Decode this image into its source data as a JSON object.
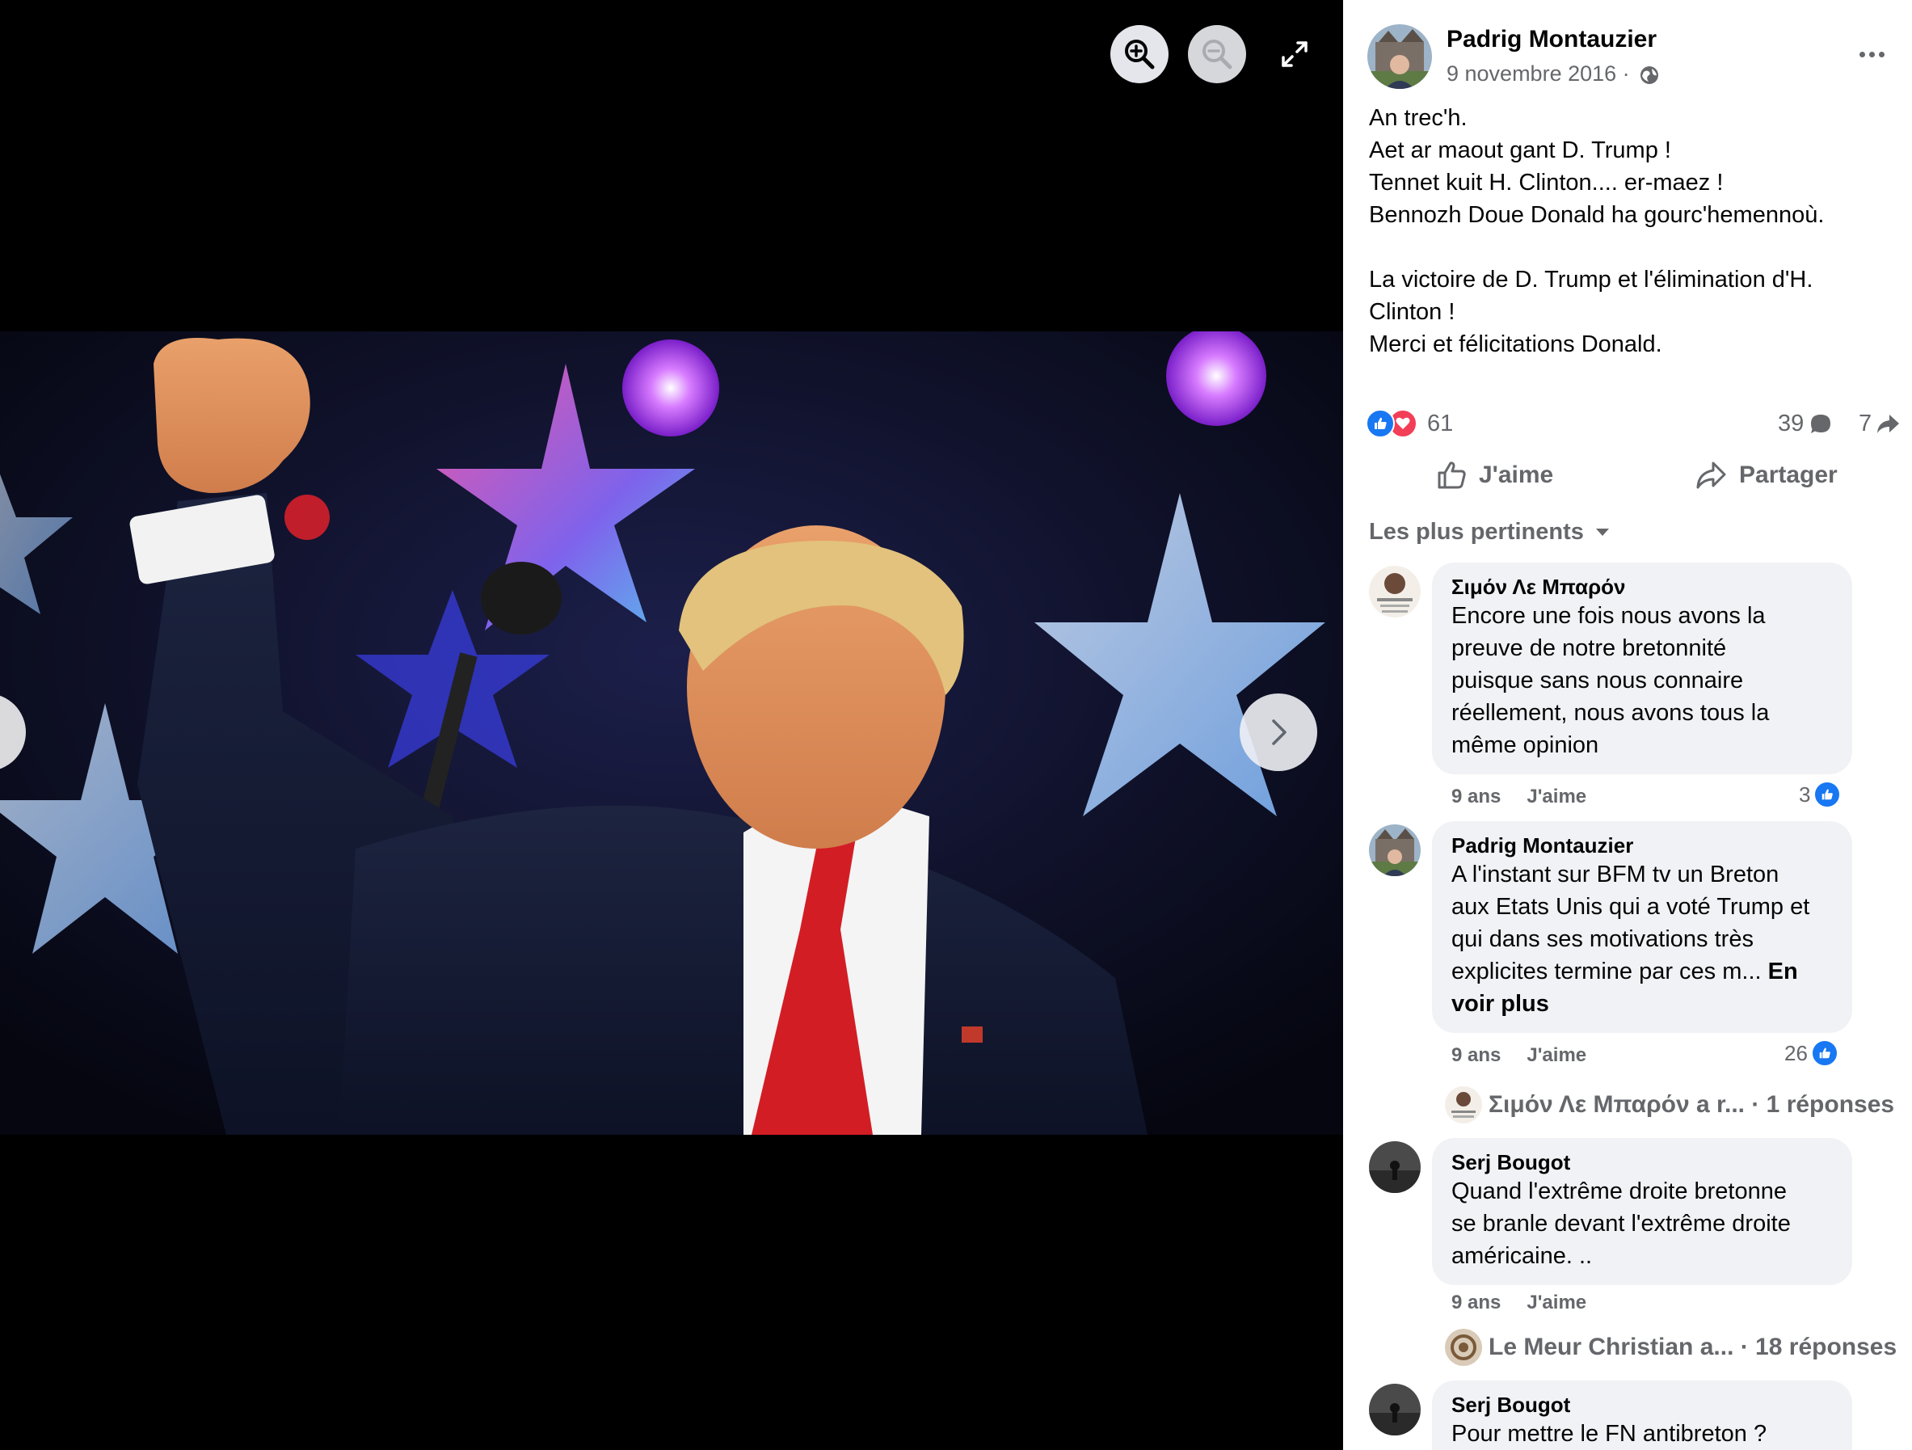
{
  "viewer": {
    "zoom_in_icon": "zoom-in-icon",
    "zoom_out_icon": "zoom-out-icon",
    "fullscreen_icon": "expand-icon",
    "next_icon": "chevron-right-icon",
    "photo": {
      "subject": "man raising fist at podium"
    }
  },
  "post": {
    "author": "Padrig Montauzier",
    "date": "9 novembre 2016 ·",
    "privacy_icon": "globe-icon",
    "text_lines": [
      "An trec'h.",
      "Aet ar maout gant D. Trump !",
      "Tennet kuit H. Clinton.... er-maez !",
      "Bennozh Doue Donald ha gourc'hemennoù.",
      "",
      "La victoire de D. Trump et l'élimination d'H.",
      "Clinton !",
      "Merci et félicitations Donald."
    ],
    "reaction_count": "61",
    "comment_count": "39",
    "share_count": "7",
    "like_label": "J'aime",
    "share_label": "Partager"
  },
  "comments_section": {
    "sort_label": "Les plus pertinents",
    "comments": [
      {
        "author": "Σιμόν Λε Μπαρόν",
        "text_lines": [
          "Encore une fois nous avons la",
          "preuve de notre bretonnité",
          "puisque sans nous connaire",
          "réellement, nous avons tous la",
          "même opinion"
        ],
        "time": "9 ans",
        "like_label": "J'aime",
        "likes": "3"
      },
      {
        "author": "Padrig Montauzier",
        "text_lines": [
          "A l'instant sur BFM tv un Breton",
          "aux Etats Unis qui a voté Trump et",
          "qui dans ses motivations très",
          "explicites termine par ces m..."
        ],
        "see_more_a": "En",
        "see_more_b": "voir plus",
        "time": "9 ans",
        "like_label": "J'aime",
        "likes": "26",
        "replies": "Σιμόν Λε Μπαρόν a r... · 1 réponses"
      },
      {
        "author": "Serj Bougot",
        "text_lines": [
          "Quand l'extrême droite bretonne",
          "se branle devant l'extrême droite",
          "américaine. .."
        ],
        "time": "9 ans",
        "like_label": "J'aime",
        "replies": "Le Meur Christian a... · 18 réponses"
      },
      {
        "author": "Serj Bougot",
        "text_lines": [
          "Pour mettre le FN antibreton ?"
        ]
      }
    ]
  },
  "colors": {
    "accent": "#1877f2",
    "love": "#f33e58",
    "secondary_text": "#65676b",
    "bubble": "#f0f2f5"
  }
}
